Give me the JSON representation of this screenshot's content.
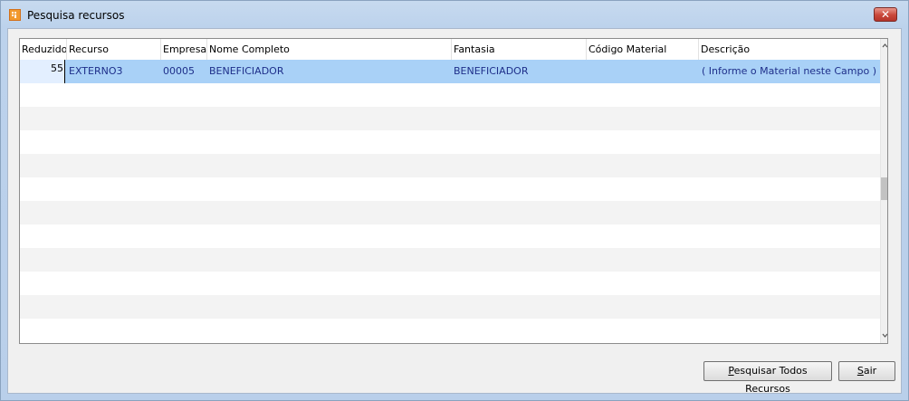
{
  "window": {
    "title": "Pesquisa recursos",
    "close_label": "✕"
  },
  "grid": {
    "columns": [
      "Reduzido",
      "Recurso",
      "Empresa",
      "Nome Completo",
      "Fantasia",
      "Código Material",
      "Descrição"
    ],
    "rows": [
      {
        "reduzido": "55",
        "recurso": "EXTERNO3",
        "empresa": "00005",
        "nome_completo": "BENEFICIADOR",
        "fantasia": "BENEFICIADOR",
        "codigo_material": "",
        "descricao": "( Informe o Material neste Campo )"
      }
    ],
    "selected_row_color": "#a9d1f7",
    "text_color": "#1e2f8a"
  },
  "buttons": {
    "search_all_first": "P",
    "search_all_rest": "esquisar Todos Recursos",
    "exit_first": "S",
    "exit_rest": "air"
  }
}
